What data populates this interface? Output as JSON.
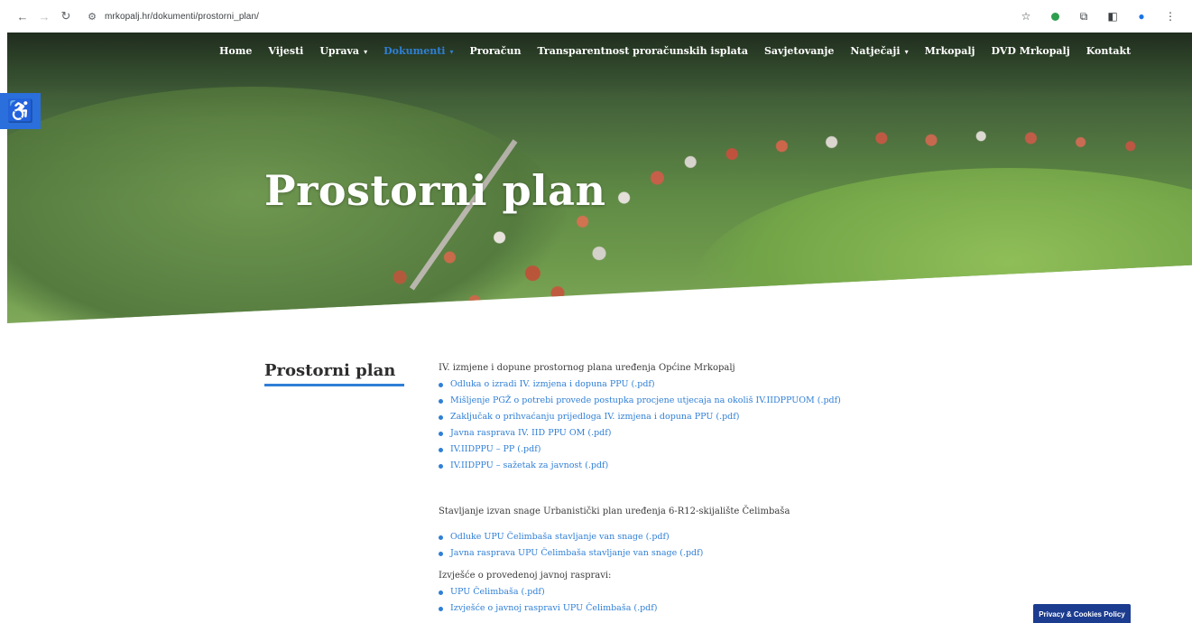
{
  "browser": {
    "url": "mrkopalj.hr/dokumenti/prostorni_plan/"
  },
  "nav": {
    "items": [
      {
        "label": "Home",
        "caret": false,
        "active": false
      },
      {
        "label": "Vijesti",
        "caret": false,
        "active": false
      },
      {
        "label": "Uprava",
        "caret": true,
        "active": false
      },
      {
        "label": "Dokumenti",
        "caret": true,
        "active": true
      },
      {
        "label": "Proračun",
        "caret": false,
        "active": false
      },
      {
        "label": "Transparentnost proračunskih isplata",
        "caret": false,
        "active": false
      },
      {
        "label": "Savjetovanje",
        "caret": false,
        "active": false
      },
      {
        "label": "Natječaji",
        "caret": true,
        "active": false
      },
      {
        "label": "Mrkopalj",
        "caret": false,
        "active": false
      },
      {
        "label": "DVD Mrkopalj",
        "caret": false,
        "active": false
      },
      {
        "label": "Kontakt",
        "caret": false,
        "active": false
      }
    ]
  },
  "hero": {
    "title": "Prostorni plan"
  },
  "sidebar": {
    "title": "Prostorni plan"
  },
  "content": {
    "section1": {
      "heading": "IV. izmjene i dopune prostornog plana uređenja Općine Mrkopalj",
      "links": [
        "Odluka o izradi IV. izmjena i dopuna PPU (.pdf)",
        "Mišljenje PGŽ o potrebi provede postupka procjene utjecaja na okoliš IV.IIDPPUOM (.pdf)",
        "Zaključak o prihvaćanju prijedloga IV. izmjena i dopuna PPU (.pdf)",
        "Javna rasprava IV. IID PPU OM (.pdf)",
        "IV.IIDPPU – PP (.pdf)",
        "IV.IIDPPU – sažetak za javnost (.pdf)"
      ]
    },
    "section2": {
      "heading": "Stavljanje izvan snage Urbanistički plan uređenja 6-R12-skijalište Čelimbaša",
      "links": [
        "Odluke UPU Čelimbaša stavljanje van snage (.pdf)",
        "Javna rasprava UPU Čelimbaša stavljanje van snage (.pdf)"
      ]
    },
    "section3": {
      "heading": "Izvješće o provedenoj javnoj raspravi:",
      "links": [
        "UPU Čelimbaša (.pdf)",
        "Izvješće o javnoj raspravi UPU Čelimbaša (.pdf)"
      ]
    }
  },
  "cookie": {
    "label": "Privacy & Cookies Policy"
  },
  "colors": {
    "accent": "#2f7fd6",
    "cookie_bg": "#1c3c8f",
    "a11y_bg": "#2a6fdb"
  }
}
